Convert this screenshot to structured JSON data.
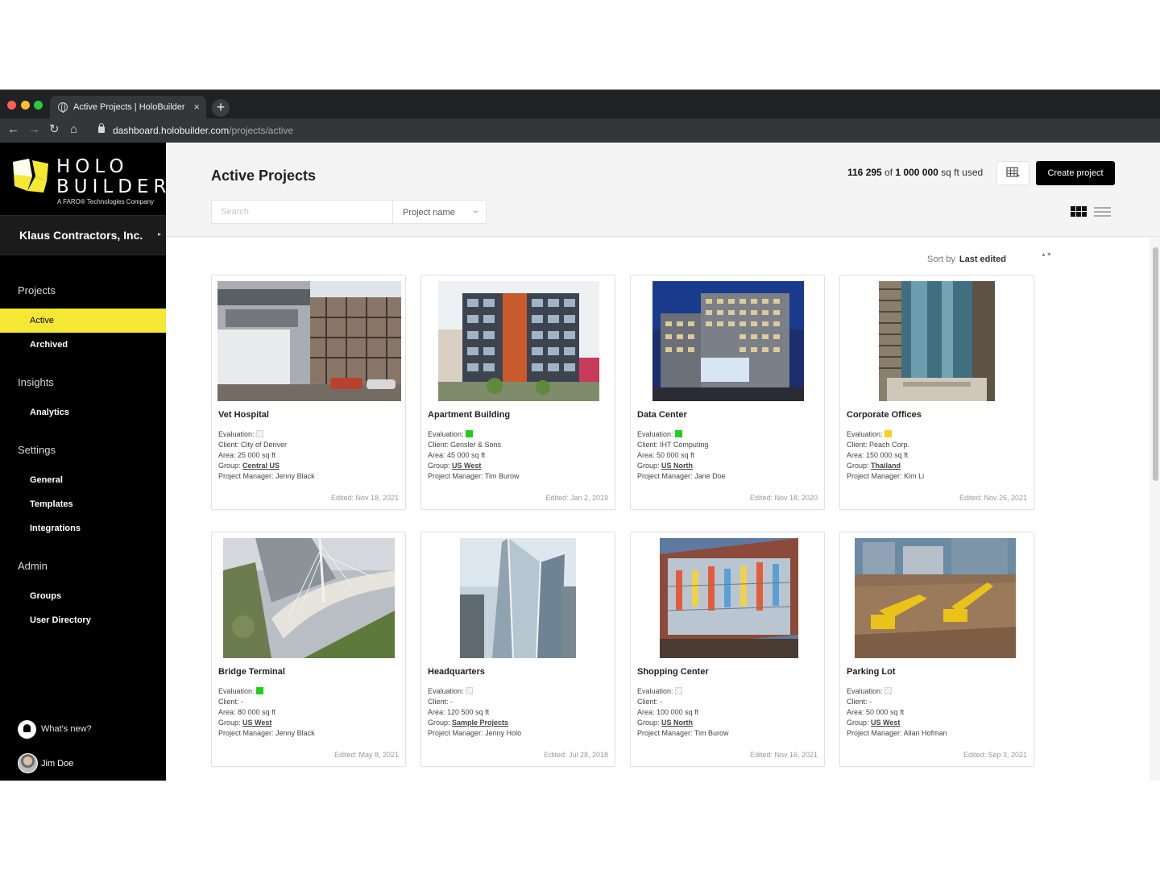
{
  "browser": {
    "tab_title": "Active Projects | HoloBuilder",
    "close_glyph": "×",
    "new_tab_glyph": "+",
    "url_host": "dashboard.holobuilder.com",
    "url_path": "/projects/active",
    "nav": {
      "back": "←",
      "forward": "→",
      "reload": "↻",
      "home": "⌂"
    }
  },
  "brand": {
    "line1": "HOLO",
    "line2": "BUILDER",
    "tagline": "A FARO® Technologies Company",
    "accent": "#f4e834"
  },
  "sidebar": {
    "company": "Klaus Contractors, Inc.",
    "company_arrow": "▸",
    "sections": [
      {
        "title": "Projects",
        "items": [
          "Active",
          "Archived"
        ]
      },
      {
        "title": "Insights",
        "items": [
          "Analytics"
        ]
      },
      {
        "title": "Settings",
        "items": [
          "General",
          "Templates",
          "Integrations"
        ]
      },
      {
        "title": "Admin",
        "items": [
          "Groups",
          "User Directory"
        ]
      }
    ],
    "active_item": "Active",
    "whats_new": "What's new?",
    "user_name": "Jim Doe"
  },
  "header": {
    "title": "Active Projects",
    "usage_used": "116 295",
    "usage_of": " of ",
    "usage_total": "1 000 000",
    "usage_suffix": " sq ft used",
    "create_button": "Create project",
    "search_placeholder": "Search",
    "search_filter": "Project name",
    "filter_chevron": "⌄"
  },
  "sort": {
    "label": "Sort by",
    "value": "Last edited",
    "arrows": "▲▼"
  },
  "labels": {
    "evaluation": "Evaluation:",
    "client": "Client:",
    "area": "Area:",
    "group": "Group:",
    "manager": "Project Manager:"
  },
  "projects": [
    {
      "name": "Vet Hospital",
      "evaluation": "none",
      "client": "City of Denver",
      "area": "25 000 sq ft",
      "group": "Central US",
      "manager": "Jenny Black",
      "edited": "Edited: Nov 18, 2021"
    },
    {
      "name": "Apartment Building",
      "evaluation": "green",
      "client": "Gensler & Sons",
      "area": "45 000 sq ft",
      "group": "US West",
      "manager": "Tim Burow",
      "edited": "Edited: Jan 2, 2019"
    },
    {
      "name": "Data Center",
      "evaluation": "green",
      "client": "IHT Computing",
      "area": "50 000 sq ft",
      "group": "US North",
      "manager": "Jane Doe",
      "edited": "Edited: Nov 18, 2020"
    },
    {
      "name": "Corporate Offices",
      "evaluation": "yellow",
      "client": "Peach Corp.",
      "area": "150 000 sq ft",
      "group": "Thailand",
      "manager": "Kim Li",
      "edited": "Edited: Nov 26, 2021"
    },
    {
      "name": "Bridge Terminal",
      "evaluation": "green",
      "client": "-",
      "area": "80 000 sq ft",
      "group": "US West",
      "manager": "Jenny Black",
      "edited": "Edited: May 8, 2021"
    },
    {
      "name": "Headquarters",
      "evaluation": "none",
      "client": "-",
      "area": "120 500 sq ft",
      "group": "Sample Projects",
      "manager": "Jenny Holo",
      "edited": "Edited: Jul 28, 2018"
    },
    {
      "name": "Shopping Center",
      "evaluation": "none",
      "client": "-",
      "area": "100 000 sq ft",
      "group": "US North",
      "manager": "Tim Burow",
      "edited": "Edited: Nov 16, 2021"
    },
    {
      "name": "Parking Lot",
      "evaluation": "none",
      "client": "-",
      "area": "50 000 sq ft",
      "group": "US West",
      "manager": "Allan Hofman",
      "edited": "Edited: Sep 3, 2021"
    }
  ]
}
